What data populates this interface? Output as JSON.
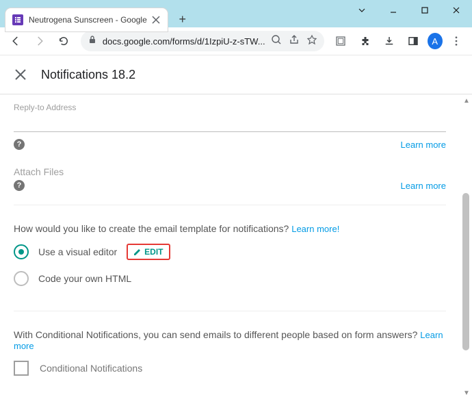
{
  "browser": {
    "tab_title": "Neutrogena Sunscreen - Google",
    "url_display": "docs.google.com/forms/d/1IzpiU-z-sTW...",
    "avatar_letter": "A"
  },
  "header": {
    "title": "Notifications 18.2"
  },
  "replyTo": {
    "label": "Reply-to Address",
    "learn_more": "Learn more"
  },
  "attach": {
    "label": "Attach Files",
    "learn_more": "Learn more"
  },
  "template": {
    "question": "How would you like to create the email template for notifications? ",
    "learn_more": "Learn more!",
    "option_visual": "Use a visual editor",
    "edit_label": "EDIT",
    "option_html": "Code your own HTML"
  },
  "conditional": {
    "text": "With Conditional Notifications, you can send emails to different people based on form answers? ",
    "learn_more": "Learn more",
    "checkbox_label": "Conditional Notifications"
  }
}
